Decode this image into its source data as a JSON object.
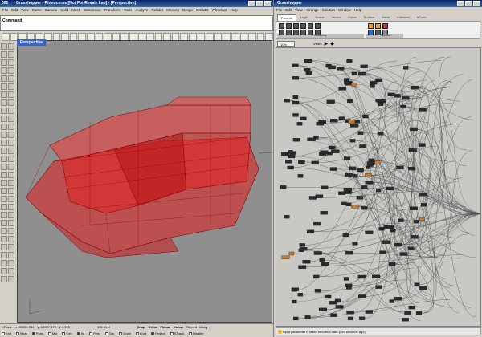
{
  "rhino": {
    "title": "Grasshopper - Rhinoceros [Not For Resale Lab] - [Perspective]",
    "title_prefix": "001",
    "menu": [
      "File",
      "Edit",
      "View",
      "Curve",
      "Surface",
      "Solid",
      "Mesh",
      "Dimension",
      "Transform",
      "Tools",
      "Analyze",
      "Render",
      "Monkey",
      "Bongo",
      "Orca3D",
      "Wheelnut",
      "Help"
    ],
    "command_label": "Command",
    "viewport_label": "Perspective",
    "status": {
      "cplane": "CPlane",
      "x": "x -59361.934",
      "y": "y -13907.476",
      "z": "z 0.000",
      "layer": "101 Keel",
      "snap": "Snap",
      "ortho": "Ortho",
      "planar": "Planar",
      "osnap": "Osnap",
      "record": "Record History"
    },
    "osnaps": [
      "End",
      "Near",
      "Point",
      "Mid",
      "Cen",
      "Int",
      "Perp",
      "Tan",
      "Quad",
      "Knot",
      "Project",
      "STrack",
      "Disable"
    ]
  },
  "gh": {
    "title": "Grasshopper",
    "menu": [
      "File",
      "Edit",
      "View",
      "Arrange",
      "Solution",
      "Window",
      "Help"
    ],
    "tabs": [
      "Params",
      "Logic",
      "Scalar",
      "Vector",
      "Curve",
      "Surface",
      "Mesh",
      "Intersect",
      "XForm"
    ],
    "panels": [
      "Geometry",
      "Primitive",
      "Special"
    ],
    "zoom": "10%",
    "views_label": "Views",
    "status": "Input parameter E failed to collect data (255 seconds ago)"
  },
  "colors": {
    "hull": "#e00000",
    "viewport_bg": "#8f8f8f",
    "titlebar": "#0a246a",
    "gh_canvas": "#c8c8c4"
  }
}
